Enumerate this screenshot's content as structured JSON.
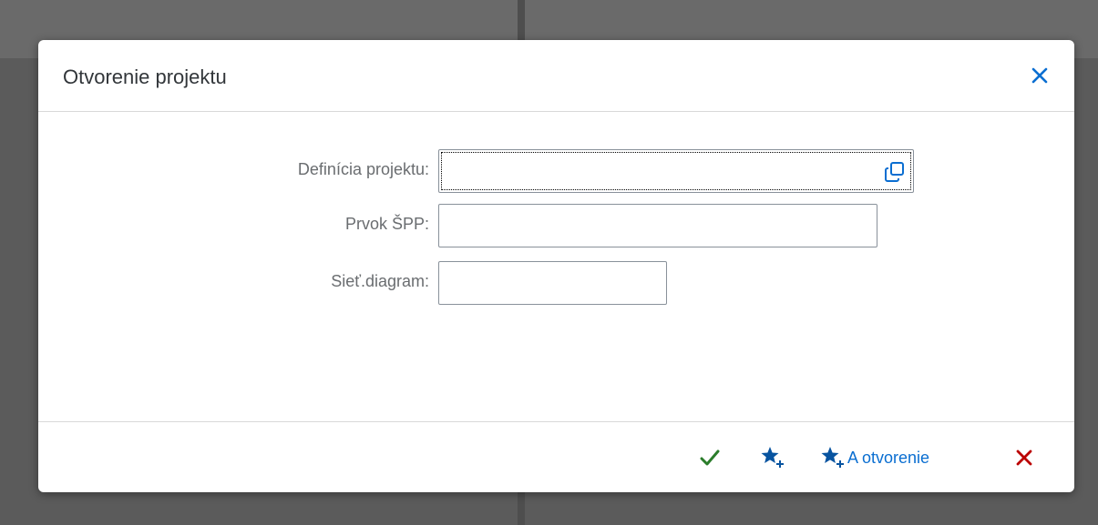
{
  "dialog": {
    "title": "Otvorenie projektu",
    "close_icon": "close-icon"
  },
  "form": {
    "project_definition": {
      "label": "Definícia projektu:",
      "value": "",
      "value_help_icon": "value-help-icon"
    },
    "wbs_element": {
      "label": "Prvok ŠPP:",
      "value": ""
    },
    "network": {
      "label": "Sieť.diagram:",
      "value": ""
    }
  },
  "footer": {
    "confirm_icon": "checkmark-icon",
    "add_favorite_icon": "add-favorite-icon",
    "add_favorite_open_label": "A otvorenie",
    "cancel_icon": "cancel-icon"
  },
  "colors": {
    "accent": "#0a6ed1",
    "confirm": "#2b7d2b",
    "cancel": "#bb0000",
    "star": "#0854a0"
  }
}
